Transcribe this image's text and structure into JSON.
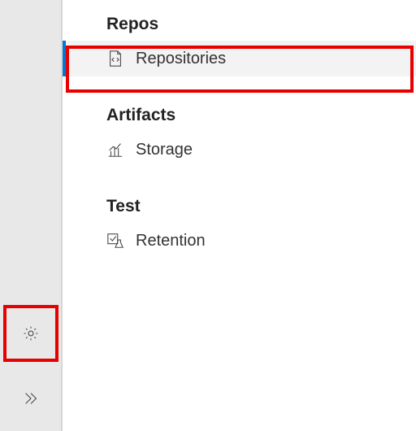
{
  "sections": [
    {
      "label": "Repos",
      "items": [
        {
          "label": "Repositories",
          "icon": "code-file-icon",
          "selected": true
        }
      ]
    },
    {
      "label": "Artifacts",
      "items": [
        {
          "label": "Storage",
          "icon": "chart-icon",
          "selected": false
        }
      ]
    },
    {
      "label": "Test",
      "items": [
        {
          "label": "Retention",
          "icon": "retention-icon",
          "selected": false
        }
      ]
    }
  ],
  "rail": {
    "settings_label": "Project settings",
    "expand_label": "Expand"
  }
}
